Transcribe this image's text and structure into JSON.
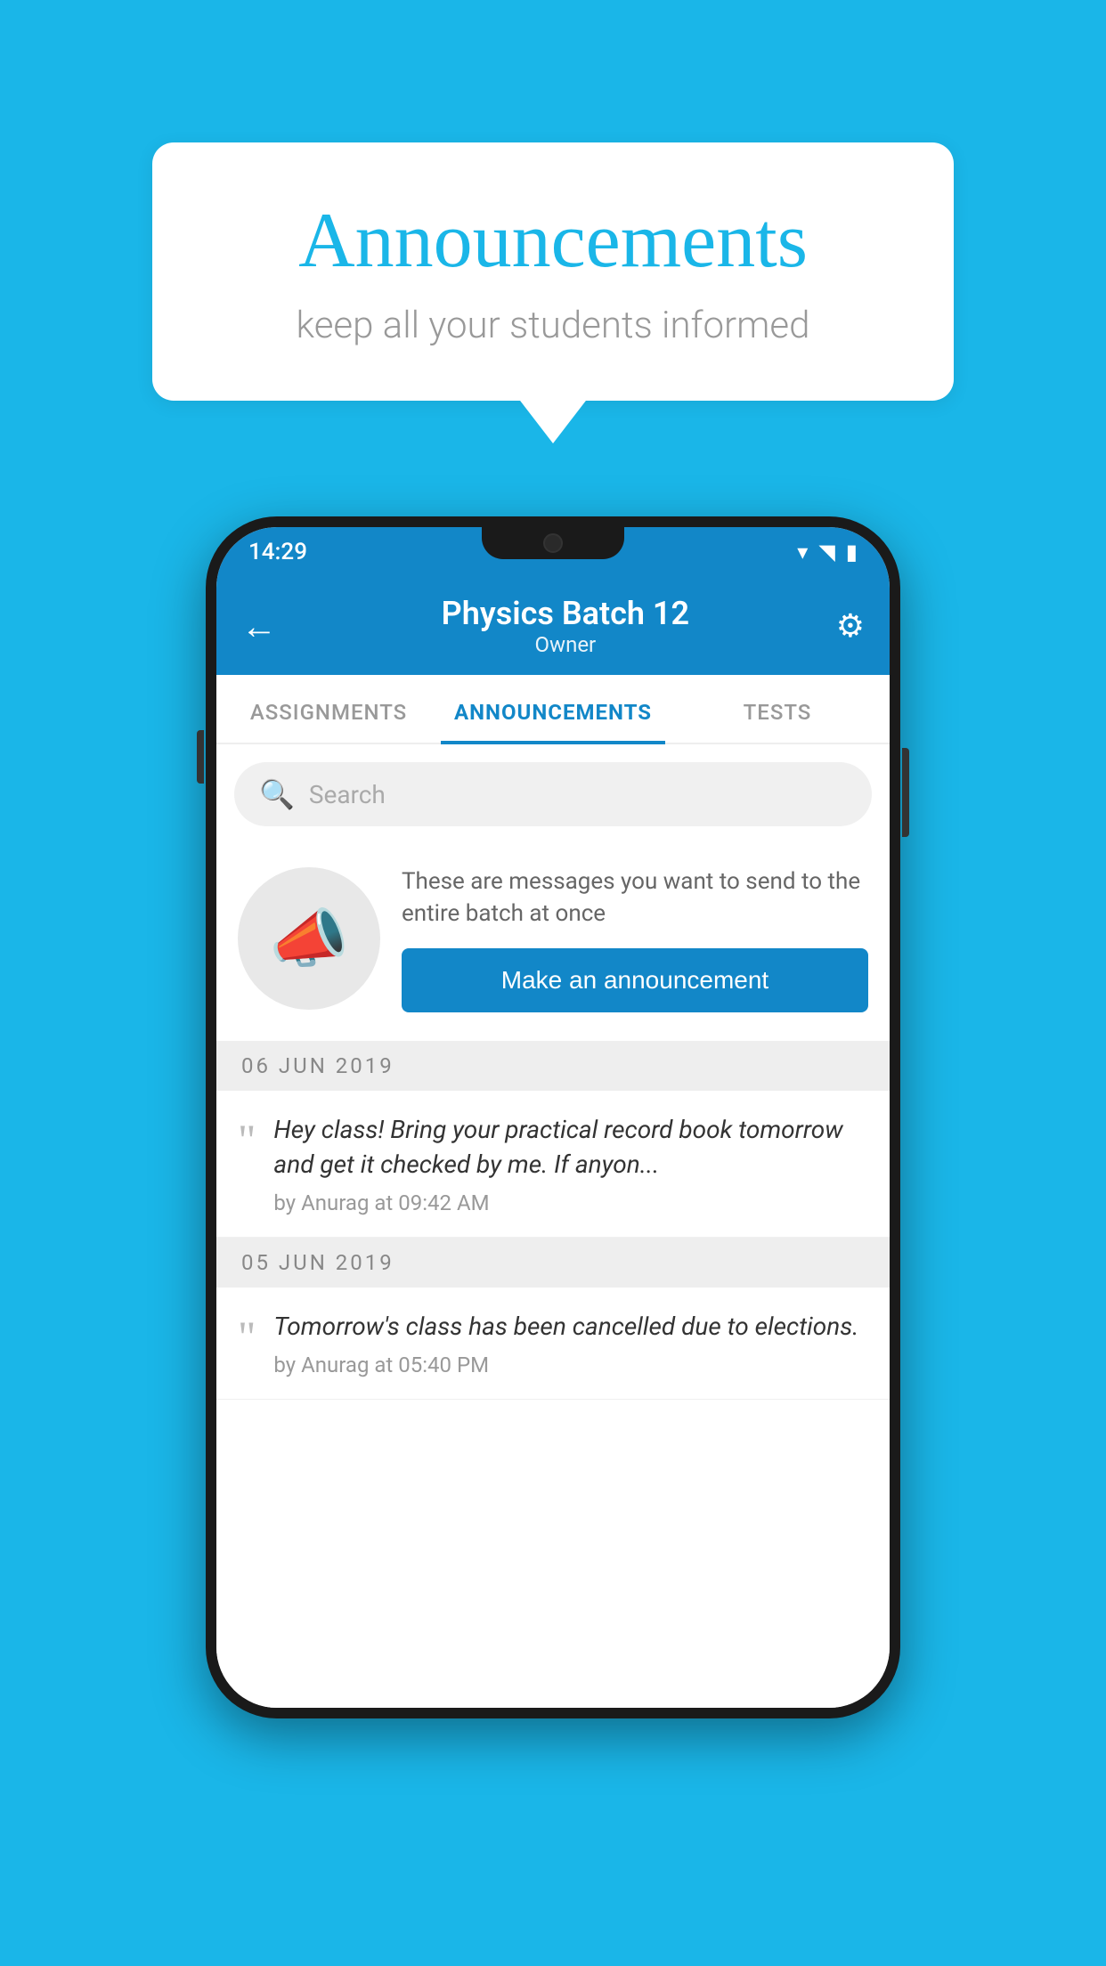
{
  "background_color": "#1ab6e8",
  "speech_bubble": {
    "title": "Announcements",
    "subtitle": "keep all your students informed"
  },
  "phone": {
    "status_bar": {
      "time": "14:29",
      "wifi": "▾",
      "signal": "▴",
      "battery": "▮"
    },
    "app_bar": {
      "back_label": "←",
      "title": "Physics Batch 12",
      "subtitle": "Owner",
      "settings_label": "⚙"
    },
    "tabs": [
      {
        "label": "ASSIGNMENTS",
        "active": false
      },
      {
        "label": "ANNOUNCEMENTS",
        "active": true
      },
      {
        "label": "TESTS",
        "active": false
      }
    ],
    "search": {
      "placeholder": "Search"
    },
    "promo": {
      "text": "These are messages you want to send to the entire batch at once",
      "button_label": "Make an announcement"
    },
    "date_groups": [
      {
        "date": "06  JUN  2019",
        "items": [
          {
            "text": "Hey class! Bring your practical record book tomorrow and get it checked by me. If anyon...",
            "meta": "by Anurag at 09:42 AM"
          }
        ]
      },
      {
        "date": "05  JUN  2019",
        "items": [
          {
            "text": "Tomorrow's class has been cancelled due to elections.",
            "meta": "by Anurag at 05:40 PM"
          }
        ]
      }
    ]
  }
}
